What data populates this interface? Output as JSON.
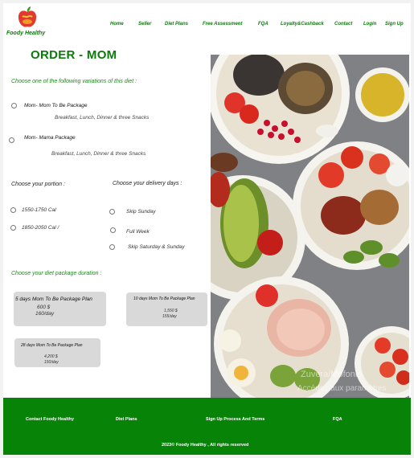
{
  "brand": {
    "name": "Foody Healthy"
  },
  "nav": [
    "Home",
    "Seller",
    "Diet Plans",
    "Free Assessment",
    "FQA",
    "Loyalty&Cashback",
    "Contact",
    "Login",
    "Sign Up"
  ],
  "page_title": "ORDER - MOM",
  "variations": {
    "label": "Choose one of the following variations of this diet :",
    "options": [
      {
        "name": "Mom- Mom To Be Package",
        "desc": "Breakfast, Lunch, Dinner & three Snacks"
      },
      {
        "name": "Mom- Mama Package",
        "desc": "Breakfast, Lunch, Dinner & three Snacks"
      }
    ]
  },
  "portion": {
    "label": "Choose your portion :",
    "options": [
      "1550-1750 Cal",
      "1850-2050 Cal /"
    ]
  },
  "delivery": {
    "label": "Choose your delivery days :",
    "options": [
      "Skip Sunday",
      "Full Week",
      "Skip Saturday & Sunday"
    ]
  },
  "duration": {
    "label": "Choose your diet package duration :",
    "packages": [
      {
        "title": "5 days Mom To Be Package Plan",
        "price": "600 $",
        "per_day": "160/day"
      },
      {
        "title": "10 days Mom To Be Package Plan",
        "price": "1,550 $",
        "per_day": "155/day"
      },
      {
        "title": "28 days Mom To Be Package Plan",
        "price": "4,200 $",
        "per_day": "150/day"
      }
    ]
  },
  "hero_image": {
    "description": "Overhead photo of several salad bowls",
    "watermark_line1": "Zuvera/Mofonio",
    "watermark_line2": "Accédez aux paramètres"
  },
  "footer": {
    "links": [
      "Contact Foody Healthy",
      "Diet Plans",
      "Sign Up Process And Terms",
      "FQA"
    ],
    "copyright": "2023© Foody Healthy , All rights reserved"
  },
  "colors": {
    "brand_green": "#0b7a0b",
    "footer_green": "#078307",
    "card_gray": "#d9d9d9"
  }
}
